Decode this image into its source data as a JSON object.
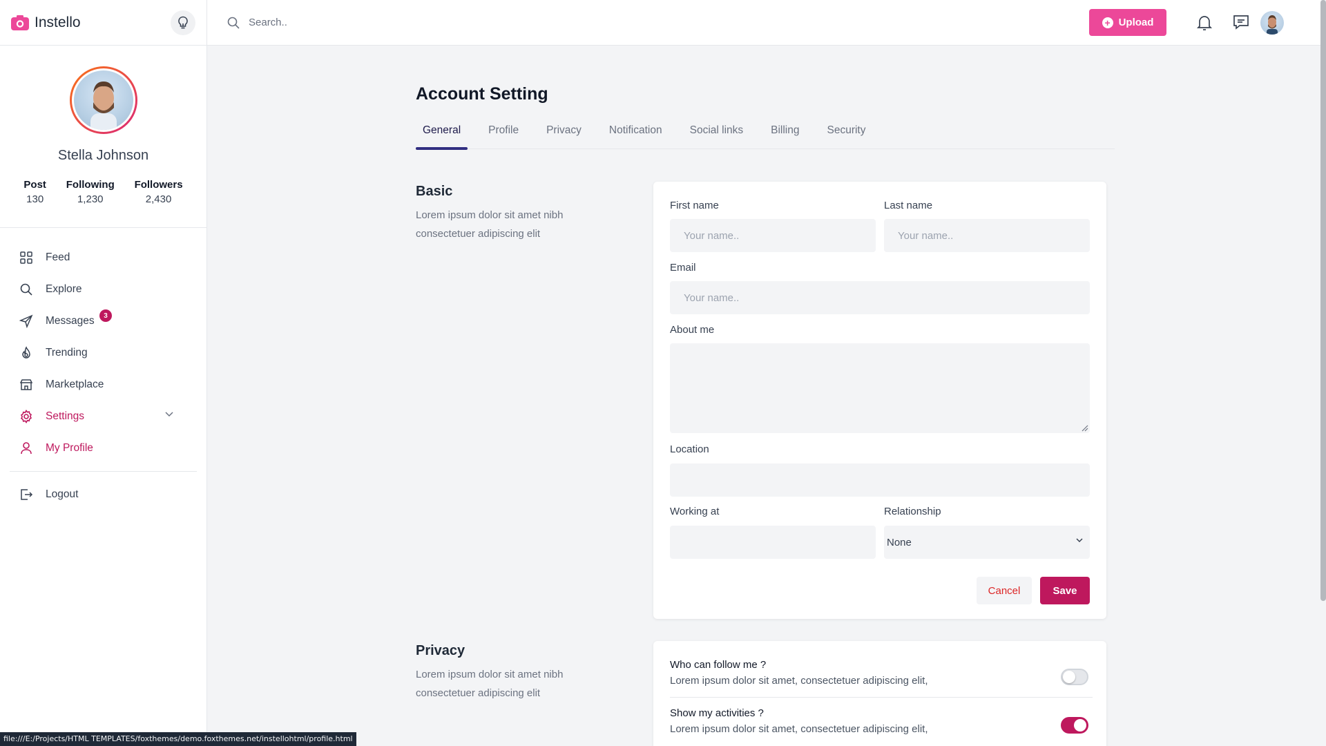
{
  "app": {
    "name": "Instello",
    "brand_color": "#ec4899",
    "accent": "#be185d"
  },
  "search": {
    "placeholder": "Search.."
  },
  "header": {
    "upload_label": "Upload"
  },
  "profile": {
    "name": "Stella Johnson",
    "stats": [
      {
        "label": "Post",
        "value": "130"
      },
      {
        "label": "Following",
        "value": "1,230"
      },
      {
        "label": "Followers",
        "value": "2,430"
      }
    ]
  },
  "sidebar": {
    "items": [
      {
        "label": "Feed",
        "icon": "grid-icon"
      },
      {
        "label": "Explore",
        "icon": "search-icon"
      },
      {
        "label": "Messages",
        "icon": "send-icon",
        "badge": "3"
      },
      {
        "label": "Trending",
        "icon": "fire-icon"
      },
      {
        "label": "Marketplace",
        "icon": "store-icon"
      },
      {
        "label": "Settings",
        "icon": "gear-icon"
      },
      {
        "label": "My Profile",
        "icon": "user-icon"
      }
    ],
    "logout": "Logout"
  },
  "page": {
    "title": "Account Setting",
    "tabs": [
      "General",
      "Profile",
      "Privacy",
      "Notification",
      "Social links",
      "Billing",
      "Security"
    ],
    "active_tab": "General"
  },
  "basic": {
    "title": "Basic",
    "desc": "Lorem ipsum dolor sit amet nibh consectetuer adipiscing elit",
    "first_name_label": "First name",
    "first_name_placeholder": "Your name..",
    "last_name_label": "Last name",
    "last_name_placeholder": "Your name..",
    "email_label": "Email",
    "email_placeholder": "Your name..",
    "about_label": "About me",
    "location_label": "Location",
    "working_label": "Working at",
    "relationship_label": "Relationship",
    "relationship_value": "None",
    "cancel_label": "Cancel",
    "save_label": "Save"
  },
  "privacy": {
    "title": "Privacy",
    "desc": "Lorem ipsum dolor sit amet nibh consectetuer adipiscing elit",
    "rows": [
      {
        "title": "Who can follow me ?",
        "desc": "Lorem ipsum dolor sit amet, consectetuer adipiscing elit,",
        "enabled": false
      },
      {
        "title": "Show my activities ?",
        "desc": "Lorem ipsum dolor sit amet, consectetuer adipiscing elit,",
        "enabled": true
      }
    ]
  },
  "status_bar": {
    "url": "file:///E:/Projects/HTML TEMPLATES/foxthemes/demo.foxthemes.net/instellohtml/profile.html"
  }
}
